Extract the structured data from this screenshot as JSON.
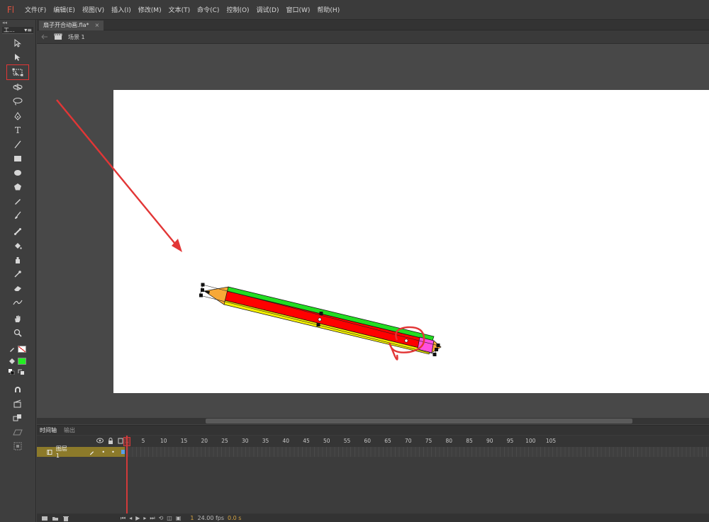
{
  "app": {
    "logo": "Fl"
  },
  "menu": [
    "文件(F)",
    "编辑(E)",
    "视图(V)",
    "插入(I)",
    "修改(M)",
    "文本(T)",
    "命令(C)",
    "控制(O)",
    "调试(D)",
    "窗口(W)",
    "帮助(H)"
  ],
  "tools_panel": {
    "collapse": "◂◂",
    "tab_label": "工...",
    "menu": "▾≡"
  },
  "document": {
    "tab_title": "扇子开合动画.fla*",
    "close": "×",
    "scene": "场景 1"
  },
  "colors": {
    "stroke": "none",
    "fill": "#22ee22",
    "highlight": "#e23636"
  },
  "icons": [
    "selection-icon",
    "subselection-icon",
    "free-transform-icon",
    "3d-rotation-icon",
    "lasso-icon",
    "pen-icon",
    "text-icon",
    "line-icon",
    "rectangle-icon",
    "oval-icon",
    "polystar-icon",
    "pencil-icon",
    "brush-icon",
    "bone-icon",
    "paint-bucket-icon",
    "ink-bottle-icon",
    "eyedropper-icon",
    "eraser-icon",
    "width-icon",
    "hand-icon",
    "zoom-icon"
  ],
  "timeline": {
    "tab_timeline": "时间轴",
    "tab_output": "输出",
    "layer_name": "图层 1",
    "ruler": [
      "1",
      "5",
      "10",
      "15",
      "20",
      "25",
      "30",
      "35",
      "40",
      "45",
      "50",
      "55",
      "60",
      "65",
      "70",
      "75",
      "80",
      "85",
      "90",
      "95",
      "100",
      "105"
    ],
    "current_frame": "1",
    "fps": "24.00 fps",
    "elapsed": "0.0 s"
  }
}
